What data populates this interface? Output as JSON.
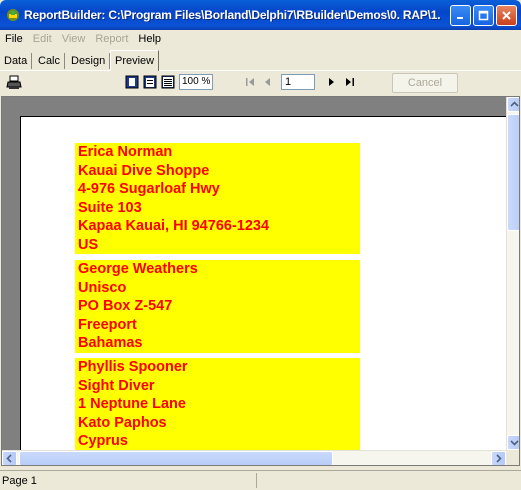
{
  "window": {
    "title": "ReportBuilder: C:\\Program Files\\Borland\\Delphi7\\RBuilder\\Demos\\0. RAP\\1. ..."
  },
  "menu": {
    "items": [
      {
        "label": "File",
        "enabled": true
      },
      {
        "label": "Edit",
        "enabled": false
      },
      {
        "label": "View",
        "enabled": false
      },
      {
        "label": "Report",
        "enabled": false
      },
      {
        "label": "Help",
        "enabled": true
      }
    ]
  },
  "tabs": [
    {
      "label": "Data"
    },
    {
      "label": "Calc"
    },
    {
      "label": "Design"
    },
    {
      "label": "Preview",
      "active": true
    }
  ],
  "toolbar": {
    "zoom_value": "100 %",
    "page_value": "1",
    "cancel_label": "Cancel",
    "icons": [
      "print-icon",
      "whole-page-icon",
      "page-width-icon",
      "hundred-percent-icon",
      "first-page-icon",
      "prior-page-icon",
      "next-page-icon",
      "last-page-icon"
    ]
  },
  "labels": [
    {
      "lines": [
        "Erica Norman",
        "Kauai Dive Shoppe",
        "4-976 Sugarloaf Hwy",
        "Suite 103",
        "Kapaa Kauai, HI 94766-1234",
        "US"
      ]
    },
    {
      "lines": [
        "George Weathers",
        "Unisco",
        "PO Box Z-547",
        "Freeport",
        "Bahamas"
      ]
    },
    {
      "lines": [
        "Phyllis Spooner",
        "Sight Diver",
        "1 Neptune Lane",
        "Kato Paphos",
        "Cyprus"
      ]
    }
  ],
  "status": {
    "page_text": "Page 1"
  },
  "colors": {
    "label_background": "#ffff00",
    "label_text": "#ff0000",
    "titlebar": "#0a52d6"
  }
}
